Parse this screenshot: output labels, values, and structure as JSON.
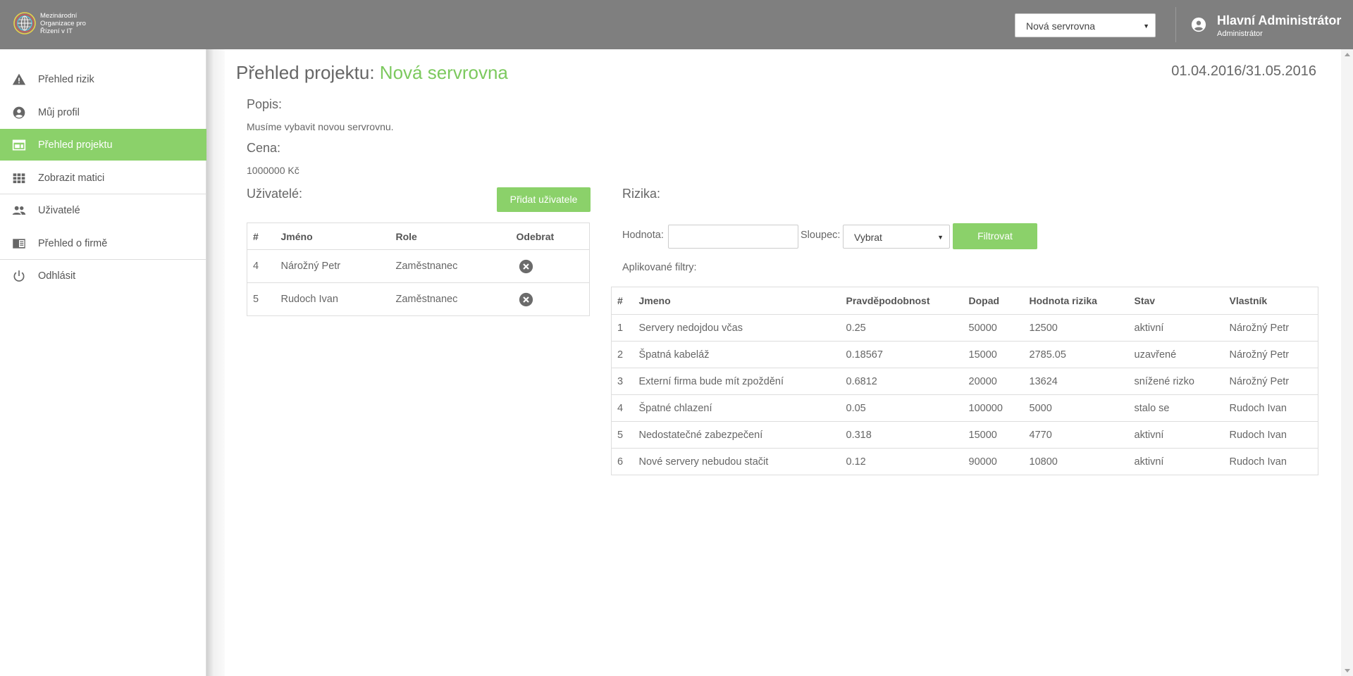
{
  "header": {
    "logo_lines": [
      "Mezinárodní",
      "Organizace pro",
      "Řízení v IT"
    ],
    "project_select": {
      "value": "Nová servrovna"
    },
    "user": {
      "name": "Hlavní Administrátor",
      "role": "Administrátor"
    }
  },
  "sidebar": {
    "items": [
      {
        "label": "Přehled rizik",
        "icon": "warning-icon"
      },
      {
        "label": "Můj profil",
        "icon": "account-circle-icon"
      },
      {
        "label": "Přehled projektu",
        "icon": "web-window-icon",
        "active": true
      },
      {
        "label": "Zobrazit matici",
        "icon": "grid-icon"
      },
      {
        "label": "Uživatelé",
        "icon": "people-icon"
      },
      {
        "label": "Přehled o firmě",
        "icon": "chrome-reader-icon"
      },
      {
        "label": "Odhlásit",
        "icon": "power-icon"
      }
    ]
  },
  "main": {
    "title_prefix": "Přehled projektu:",
    "project_name": "Nová servrovna",
    "date_range": "01.04.2016/31.05.2016",
    "description_label": "Popis:",
    "description": "Musíme vybavit novou servrovnu.",
    "price_label": "Cena:",
    "price": "1000000 Kč",
    "users": {
      "heading": "Uživatelé:",
      "add_button": "Přidat uživatele",
      "columns": [
        "#",
        "Jméno",
        "Role",
        "Odebrat"
      ],
      "rows": [
        {
          "id": "4",
          "name": "Nárožný Petr",
          "role": "Zaměstnanec"
        },
        {
          "id": "5",
          "name": "Rudoch Ivan",
          "role": "Zaměstnanec"
        }
      ]
    },
    "risks": {
      "heading": "Rizika:",
      "filter": {
        "value_label": "Hodnota:",
        "value": "",
        "column_label": "Sloupec:",
        "column_value": "Vybrat",
        "button": "Filtrovat",
        "applied_label": "Aplikované filtry:"
      },
      "columns": [
        "#",
        "Jmeno",
        "Pravděpodobnost",
        "Dopad",
        "Hodnota rizika",
        "Stav",
        "Vlastník"
      ],
      "rows": [
        [
          "1",
          "Servery nedojdou včas",
          "0.25",
          "50000",
          "12500",
          "aktivní",
          "Nárožný Petr"
        ],
        [
          "2",
          "Špatná kabeláž",
          "0.18567",
          "15000",
          "2785.05",
          "uzavřené",
          "Nárožný Petr"
        ],
        [
          "3",
          "Externí firma bude mít zpoždění",
          "0.6812",
          "20000",
          "13624",
          "snížené rizko",
          "Nárožný Petr"
        ],
        [
          "4",
          "Špatné chlazení",
          "0.05",
          "100000",
          "5000",
          "stalo se",
          "Rudoch Ivan"
        ],
        [
          "5",
          "Nedostatečné zabezpečení",
          "0.318",
          "15000",
          "4770",
          "aktivní",
          "Rudoch Ivan"
        ],
        [
          "6",
          "Nové servery nebudou stačit",
          "0.12",
          "90000",
          "10800",
          "aktivní",
          "Rudoch Ivan"
        ]
      ]
    }
  },
  "colors": {
    "topbar": "#7f7f7f",
    "accent_green": "#8bd16a",
    "project_green": "#7cc95e"
  }
}
